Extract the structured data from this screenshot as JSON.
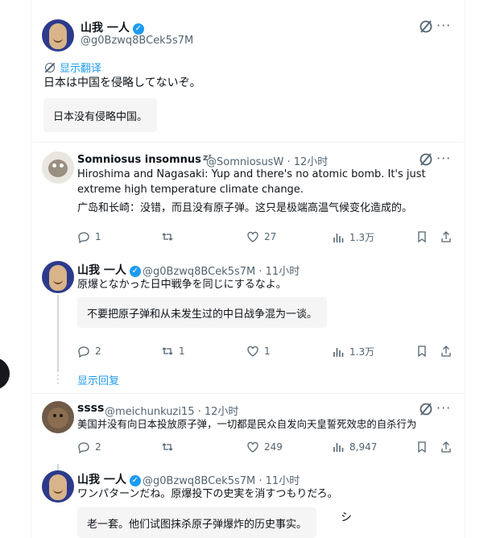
{
  "tweet_main": {
    "name": "山我 一人",
    "handle": "@g0Bzwq8BCek5s7M",
    "show_translation": "显示翻译",
    "text": "日本は中国を侵略してないぞ。",
    "translation": "日本没有侵略中国。"
  },
  "reply1": {
    "name": "Somniosus insomnus",
    "zz": "zᶻ",
    "handle": "@SomniosusW",
    "time": "· 12小时",
    "text": "Hiroshima and Nagasaki: Yup and there's no atomic bomb. It's just extreme high temperature climate change.",
    "translation": "广岛和长崎：没错，而且没有原子弹。这只是极端高温气候变化造成的。",
    "replies": "1",
    "retweets": "",
    "likes": "27",
    "views": "1.3万"
  },
  "reply2": {
    "name": "山我 一人",
    "handle": "@g0Bzwq8BCek5s7M",
    "time": "· 11小时",
    "text": "原爆となかった日中戦争を同じにするなよ。",
    "translation": "不要把原子弹和从未发生过的中日战争混为一谈。",
    "replies": "2",
    "retweets": "1",
    "likes": "1",
    "views": "1.3万"
  },
  "show_replies": "显示回复",
  "reply3": {
    "name": "ssss",
    "handle": "@meichunkuzi15",
    "time": "· 12小时",
    "text": "美国并没有向日本投放原子弹，一切都是民众自发向天皇誓死效忠的自杀行为",
    "replies": "2",
    "retweets": "",
    "likes": "249",
    "views": "8,947"
  },
  "reply4": {
    "name": "山我 一人",
    "handle": "@g0Bzwq8BCek5s7M",
    "time": "· 11小时",
    "text": "ワンパターンだね。原爆投下の史実を消すつもりだろ。",
    "translation": "老一套。他们试图抹杀原子弹爆炸的历史事实。",
    "float_char": "シ"
  },
  "icons": {
    "more": "more-icon",
    "grok": "grok-icon",
    "verified": "verified-icon",
    "reply": "reply-icon",
    "retweet": "retweet-icon",
    "like": "like-icon",
    "views": "views-icon",
    "bookmark": "bookmark-icon",
    "share": "share-icon"
  },
  "colors": {
    "link": "#1d9bf0",
    "secondary": "#536471",
    "border": "#eff3f4"
  }
}
